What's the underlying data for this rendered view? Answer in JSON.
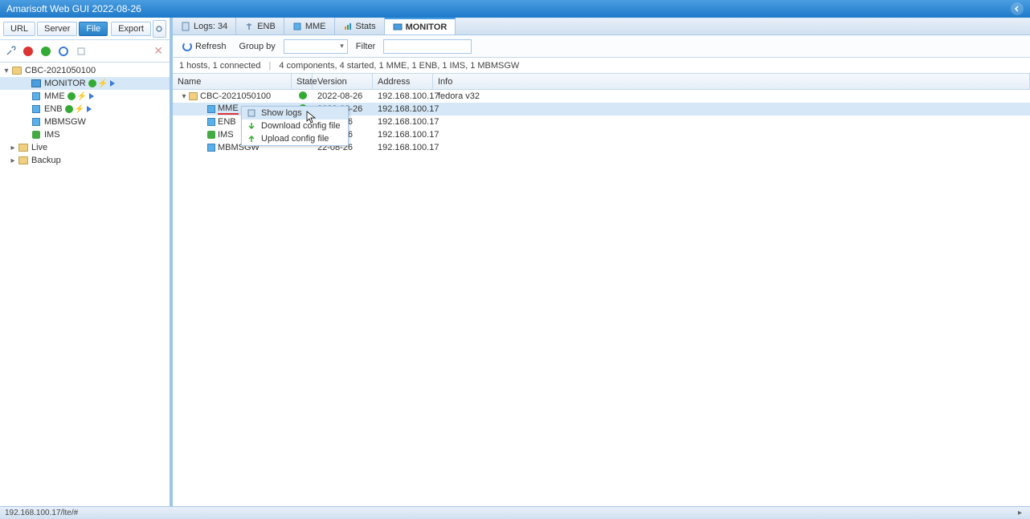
{
  "header": {
    "title": "Amarisoft Web GUI 2022-08-26"
  },
  "left": {
    "toolbar": {
      "url": "URL",
      "server": "Server",
      "file": "File",
      "export": "Export"
    },
    "tree": {
      "root": "CBC-2021050100",
      "monitor": "MONITOR",
      "mme": "MME",
      "enb": "ENB",
      "mbmsgw": "MBMSGW",
      "ims": "IMS",
      "live": "Live",
      "backup": "Backup"
    }
  },
  "tabs": {
    "logs": "Logs: 34",
    "enb": "ENB",
    "mme": "MME",
    "stats": "Stats",
    "monitor": "MONITOR"
  },
  "right_toolbar": {
    "refresh": "Refresh",
    "groupby": "Group by",
    "filter": "Filter"
  },
  "status": {
    "hosts": "1 hosts, 1 connected",
    "components": "4 components, 4 started, 1 MME, 1 ENB, 1 IMS, 1 MBMSGW"
  },
  "grid": {
    "headers": {
      "name": "Name",
      "state": "State",
      "version": "Version",
      "address": "Address",
      "info": "Info"
    },
    "rows": [
      {
        "name": "CBC-2021050100",
        "version": "2022-08-26",
        "address": "192.168.100.17",
        "info": "fedora v32",
        "indent": 0,
        "icon": "folder",
        "state": "ok"
      },
      {
        "name": "MME",
        "version": "2022-08-26",
        "address": "192.168.100.17",
        "info": "",
        "indent": 1,
        "icon": "comp",
        "state": "ok",
        "highlight": true,
        "redline": true
      },
      {
        "name": "ENB",
        "version": "22-08-26",
        "address": "192.168.100.17",
        "info": "",
        "indent": 1,
        "icon": "comp",
        "state": ""
      },
      {
        "name": "IMS",
        "version": "22-08-26",
        "address": "192.168.100.17",
        "info": "",
        "indent": 1,
        "icon": "phone",
        "state": ""
      },
      {
        "name": "MBMSGW",
        "version": "22-08-26",
        "address": "192.168.100.17",
        "info": "",
        "indent": 1,
        "icon": "comp",
        "state": ""
      }
    ]
  },
  "ctx": {
    "show_logs": "Show logs",
    "download": "Download config file",
    "upload": "Upload config file"
  },
  "statusbar": {
    "text": "192.168.100.17/lte/#"
  }
}
